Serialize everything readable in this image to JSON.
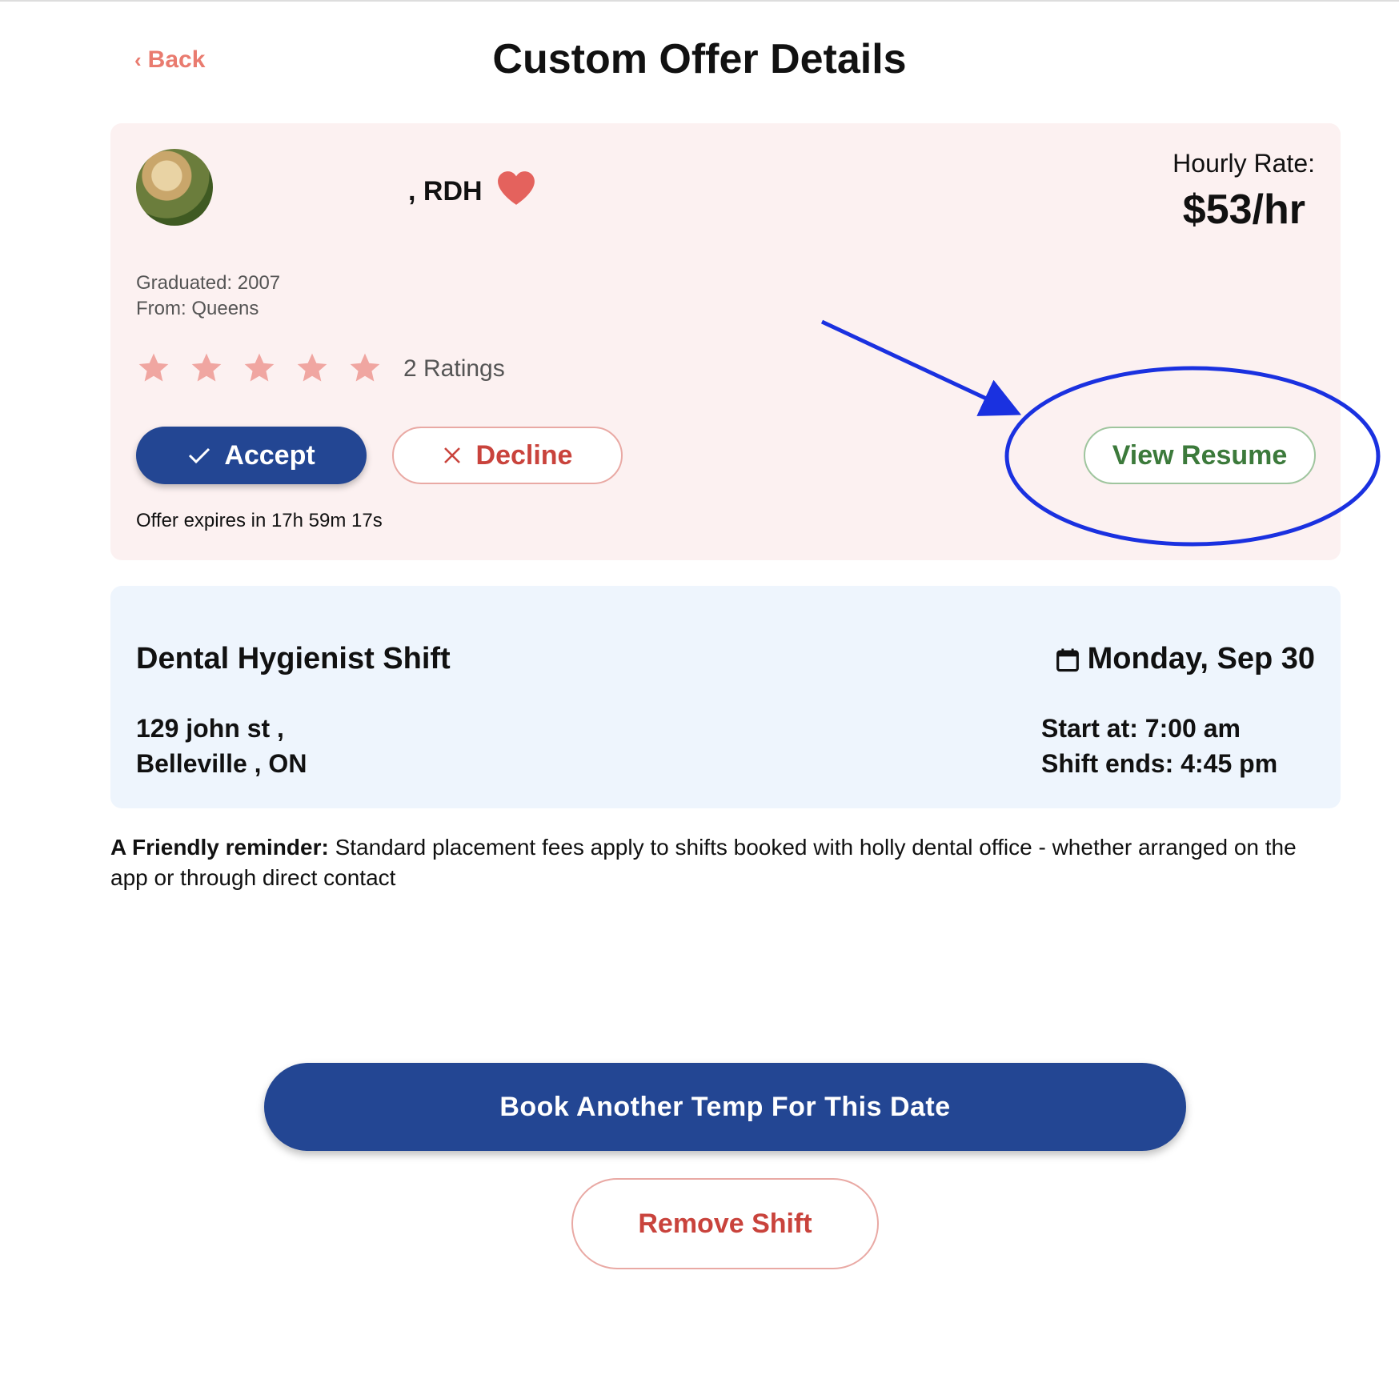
{
  "header": {
    "back_label": "Back",
    "title": "Custom Offer Details"
  },
  "offer": {
    "name_suffix": ", RDH",
    "hourly_rate_label": "Hourly Rate:",
    "hourly_rate_value": "$53/hr",
    "graduated": "Graduated: 2007",
    "from": "From: Queens",
    "rating_stars": 5,
    "ratings_count": "2 Ratings",
    "accept_label": "Accept",
    "decline_label": "Decline",
    "view_resume_label": "View Resume",
    "expires_text": "Offer expires in 17h 59m 17s",
    "colors": {
      "star": "#f0a6a1",
      "heart": "#e4625d",
      "card_bg": "#fcf1f1"
    }
  },
  "shift": {
    "title": "Dental Hygienist Shift",
    "date": "Monday, Sep 30",
    "address_line1": "129 john st ,",
    "address_line2": "Belleville , ON",
    "start": "Start at: 7:00 am",
    "end": "Shift ends: 4:45 pm"
  },
  "reminder": {
    "bold_prefix": "A Friendly reminder:",
    "text": " Standard placement fees apply to shifts booked with holly dental office - whether arranged on the app or through direct contact"
  },
  "actions": {
    "book_another_label": "Book Another Temp For This Date",
    "remove_shift_label": "Remove Shift"
  },
  "annotation": {
    "color": "#1a31e0"
  }
}
